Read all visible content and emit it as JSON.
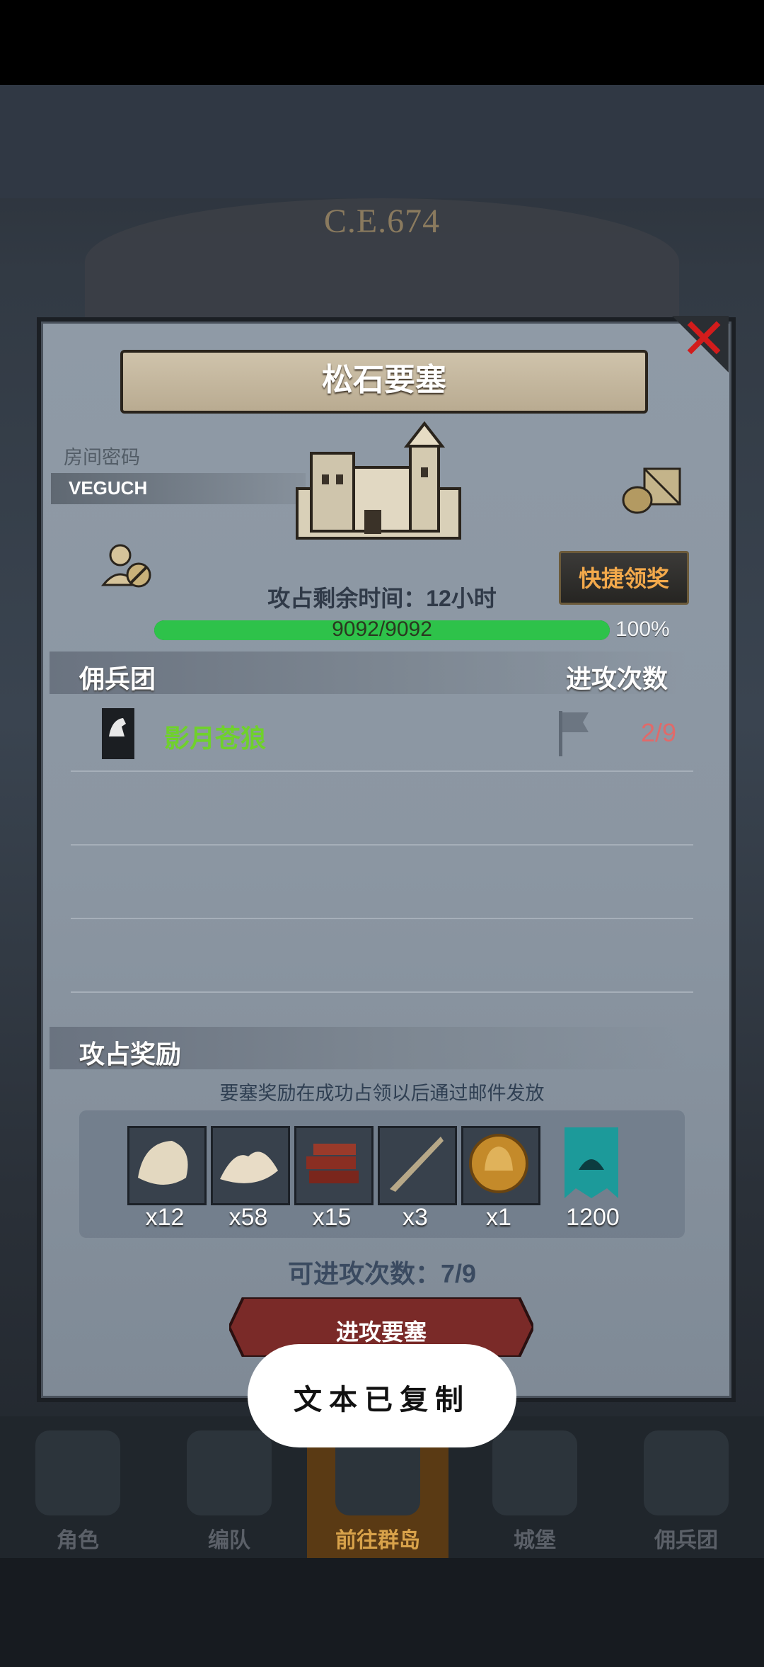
{
  "header": {
    "year": "C.E.674"
  },
  "dialog": {
    "title": "松石要塞",
    "room_password_label": "房间密码",
    "room_password_value": "VEGUCH",
    "quick_claim_label": "快捷领奖",
    "time_remaining": "攻占剩余时间：12小时",
    "health": {
      "current": 9092,
      "max": 9092,
      "text": "9092/9092",
      "percent_text": "100%",
      "fraction": 1.0
    },
    "mercenary_section": {
      "title": "佣兵团",
      "attacks_header": "进攻次数"
    },
    "mercenaries": [
      {
        "name": "影月苍狼",
        "attacks": "2/9"
      }
    ],
    "reward_section": {
      "title": "攻占奖励",
      "note": "要塞奖励在成功占领以后通过邮件发放",
      "items": [
        {
          "icon": "fur-pelt-icon",
          "qty": "x12"
        },
        {
          "icon": "wool-icon",
          "qty": "x58"
        },
        {
          "icon": "wood-planks-icon",
          "qty": "x15"
        },
        {
          "icon": "horn-icon",
          "qty": "x3"
        },
        {
          "icon": "knight-helmet-coin-icon",
          "qty": "x1"
        },
        {
          "icon": "teal-banner-icon",
          "qty": "1200"
        }
      ]
    },
    "attempts_remaining": "可进攻次数：7/9",
    "attack_button": "进攻要塞"
  },
  "toast": "文本已复制",
  "bottom_nav": [
    {
      "label": "角色",
      "active": false
    },
    {
      "label": "编队",
      "active": false
    },
    {
      "label": "前往群岛",
      "active": true
    },
    {
      "label": "城堡",
      "active": false
    },
    {
      "label": "佣兵团",
      "active": false
    }
  ],
  "colors": {
    "hp_fill": "#2ec24a",
    "merc_name": "#6fd12c",
    "count_red": "#e06a6a",
    "quick_claim": "#f3a94b",
    "close_red": "#d21c1c"
  }
}
